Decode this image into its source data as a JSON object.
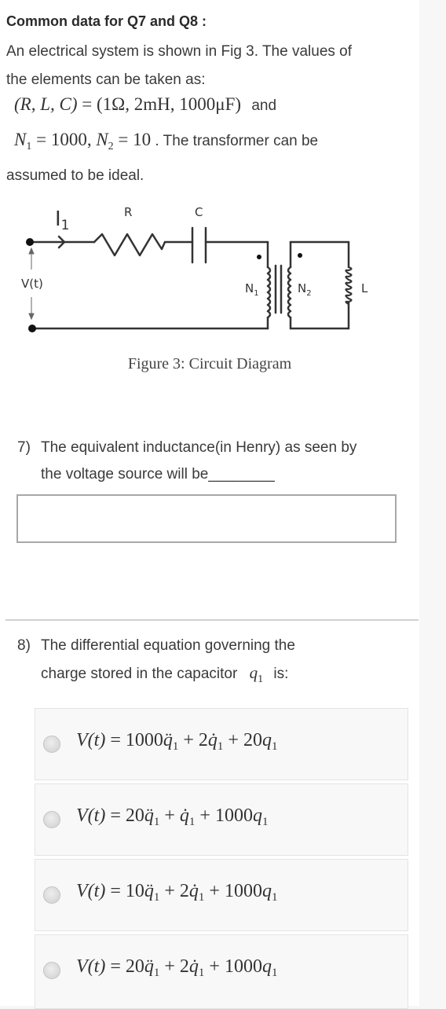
{
  "intro": {
    "title": "Common data for Q7 and Q8 :",
    "line1": "An electrical system is shown in Fig 3. The values of",
    "line2": "the elements can be taken as:",
    "values_lhs": "(R, L, C)",
    "values_eq": " = ",
    "values_rhs": "(1Ω,  2mH,  1000μF)",
    "values_tail": "and",
    "turns_n1": "N",
    "turns_n1_sub": "1",
    "turns_n1_val": " = 1000, ",
    "turns_n2": "N",
    "turns_n2_sub": "2",
    "turns_n2_val": " = 10",
    "turns_tail": " . The transformer can be",
    "line5": "assumed to be ideal."
  },
  "figure": {
    "labels": {
      "current": "I",
      "current_sub": "1",
      "resistor": "R",
      "capacitor": "C",
      "source": "V(t)",
      "primary": "N",
      "primary_sub": "1",
      "secondary": "N",
      "secondary_sub": "2",
      "inductor": "L"
    },
    "caption": "Figure 3:  Circuit Diagram"
  },
  "q7": {
    "number": "7)",
    "text_line1": "The equivalent inductance(in Henry) as seen by",
    "text_line2": "the voltage source will be________",
    "answer_value": "",
    "answer_placeholder": ""
  },
  "q8": {
    "number": "8)",
    "text_line1": "The differential equation governing the",
    "text_line2": "charge stored in the capacitor",
    "var": "q",
    "var_sub": "1",
    "text_tail": "is:",
    "options": [
      {
        "lhs": "V(t)",
        "a": "1000",
        "b": "2",
        "c": "20",
        "selected": false
      },
      {
        "lhs": "V(t)",
        "a": "20",
        "b": "",
        "c": "1000",
        "selected": false
      },
      {
        "lhs": "V(t)",
        "a": "10",
        "b": "2",
        "c": "1000",
        "selected": false
      },
      {
        "lhs": "V(t)",
        "a": "20",
        "b": "2",
        "c": "1000",
        "selected": false
      }
    ]
  },
  "colors": {
    "page_bg": "#ffffff",
    "side_bg": "#f7f7f7",
    "option_bg": "#f8f8f8",
    "text": "#333333"
  }
}
